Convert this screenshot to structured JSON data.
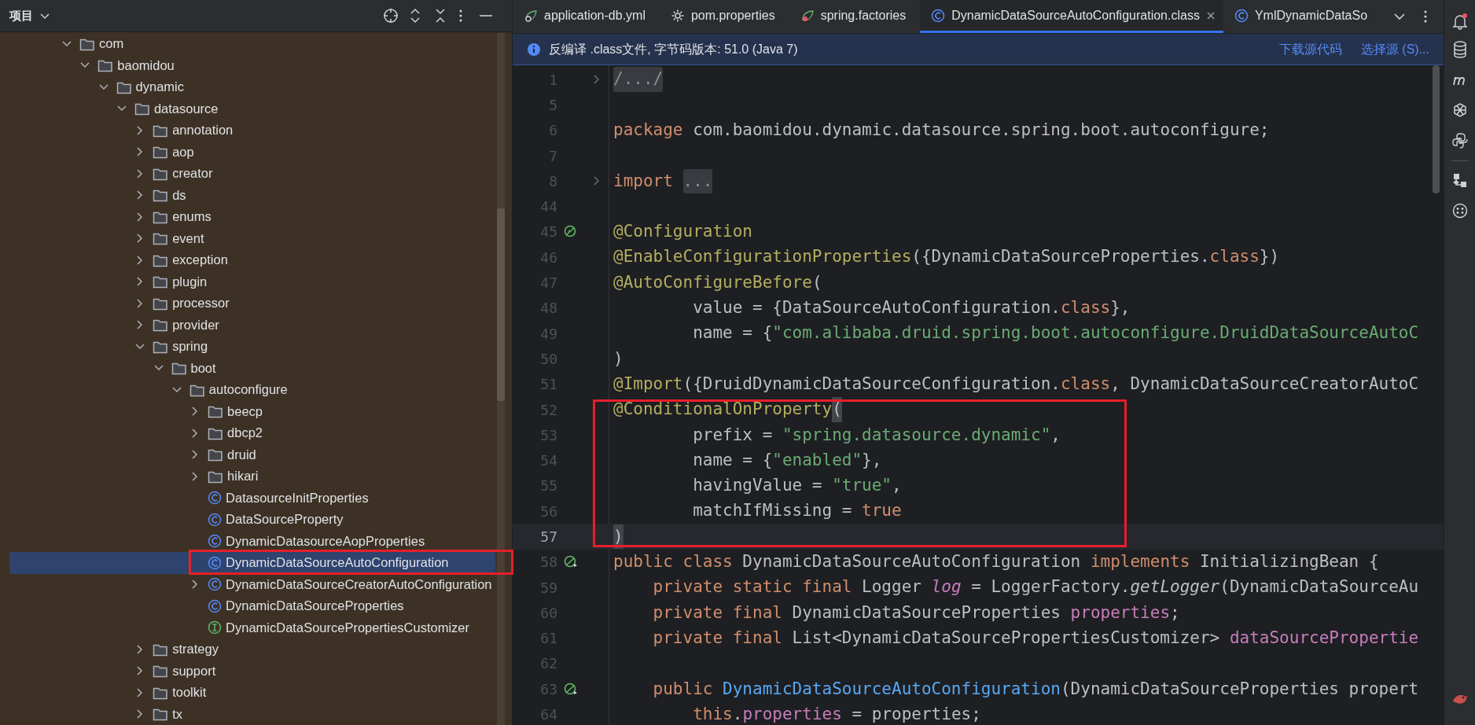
{
  "project": {
    "title": "项目",
    "tree": [
      {
        "label": "com",
        "kind": "folder",
        "expanded": true,
        "selected": false,
        "children": [
          {
            "label": "baomidou",
            "kind": "folder",
            "expanded": true,
            "selected": false,
            "children": [
              {
                "label": "dynamic",
                "kind": "folder",
                "expanded": true,
                "selected": false,
                "children": [
                  {
                    "label": "datasource",
                    "kind": "folder",
                    "expanded": true,
                    "selected": false,
                    "children": [
                      {
                        "label": "annotation",
                        "kind": "folder",
                        "expanded": false,
                        "selected": false
                      },
                      {
                        "label": "aop",
                        "kind": "folder",
                        "expanded": false,
                        "selected": false
                      },
                      {
                        "label": "creator",
                        "kind": "folder",
                        "expanded": false,
                        "selected": false
                      },
                      {
                        "label": "ds",
                        "kind": "folder",
                        "expanded": false,
                        "selected": false
                      },
                      {
                        "label": "enums",
                        "kind": "folder",
                        "expanded": false,
                        "selected": false
                      },
                      {
                        "label": "event",
                        "kind": "folder",
                        "expanded": false,
                        "selected": false
                      },
                      {
                        "label": "exception",
                        "kind": "folder",
                        "expanded": false,
                        "selected": false
                      },
                      {
                        "label": "plugin",
                        "kind": "folder",
                        "expanded": false,
                        "selected": false
                      },
                      {
                        "label": "processor",
                        "kind": "folder",
                        "expanded": false,
                        "selected": false
                      },
                      {
                        "label": "provider",
                        "kind": "folder",
                        "expanded": false,
                        "selected": false
                      },
                      {
                        "label": "spring",
                        "kind": "folder",
                        "expanded": true,
                        "selected": false,
                        "children": [
                          {
                            "label": "boot",
                            "kind": "folder",
                            "expanded": true,
                            "selected": false,
                            "children": [
                              {
                                "label": "autoconfigure",
                                "kind": "folder",
                                "expanded": true,
                                "selected": false,
                                "children": [
                                  {
                                    "label": "beecp",
                                    "kind": "folder",
                                    "expanded": false,
                                    "selected": false
                                  },
                                  {
                                    "label": "dbcp2",
                                    "kind": "folder",
                                    "expanded": false,
                                    "selected": false
                                  },
                                  {
                                    "label": "druid",
                                    "kind": "folder",
                                    "expanded": false,
                                    "selected": false
                                  },
                                  {
                                    "label": "hikari",
                                    "kind": "folder",
                                    "expanded": false,
                                    "selected": false
                                  },
                                  {
                                    "label": "DatasourceInitProperties",
                                    "kind": "class",
                                    "selected": false
                                  },
                                  {
                                    "label": "DataSourceProperty",
                                    "kind": "class",
                                    "selected": false
                                  },
                                  {
                                    "label": "DynamicDatasourceAopProperties",
                                    "kind": "class",
                                    "selected": false
                                  },
                                  {
                                    "label": "DynamicDataSourceAutoConfiguration",
                                    "kind": "class",
                                    "selected": true
                                  },
                                  {
                                    "label": "DynamicDataSourceCreatorAutoConfiguration",
                                    "kind": "class",
                                    "expanded": false,
                                    "selected": false
                                  },
                                  {
                                    "label": "DynamicDataSourceProperties",
                                    "kind": "class",
                                    "selected": false
                                  },
                                  {
                                    "label": "DynamicDataSourcePropertiesCustomizer",
                                    "kind": "interface",
                                    "selected": false
                                  }
                                ]
                              }
                            ]
                          }
                        ]
                      },
                      {
                        "label": "strategy",
                        "kind": "folder",
                        "expanded": false,
                        "selected": false
                      },
                      {
                        "label": "support",
                        "kind": "folder",
                        "expanded": false,
                        "selected": false
                      },
                      {
                        "label": "toolkit",
                        "kind": "folder",
                        "expanded": false,
                        "selected": false
                      },
                      {
                        "label": "tx",
                        "kind": "folder",
                        "expanded": false,
                        "selected": false
                      }
                    ]
                  }
                ]
              }
            ]
          }
        ]
      }
    ]
  },
  "editor": {
    "tabs": [
      {
        "label": "application-db.yml",
        "kind": "spring-config",
        "selected": false
      },
      {
        "label": "pom.properties",
        "kind": "properties",
        "selected": false
      },
      {
        "label": "spring.factories",
        "kind": "spring-factories",
        "selected": false
      },
      {
        "label": "DynamicDataSourceAutoConfiguration.class",
        "kind": "class",
        "selected": true
      },
      {
        "label": "YmlDynamicDataSo",
        "kind": "class",
        "selected": false
      }
    ],
    "notice": {
      "text": "反编译 .class文件, 字节码版本: 51.0 (Java 7)",
      "links": [
        "下载源代码",
        "选择源 (S)..."
      ]
    },
    "lines": [
      {
        "number": "1",
        "fold_marker": true,
        "current": false,
        "tokens": [
          {
            "kind": "folded",
            "text": "/.../"
          }
        ]
      },
      {
        "number": "5",
        "current": false
      },
      {
        "number": "6",
        "current": false,
        "tokens": [
          {
            "kind": "keyword",
            "text": "package"
          },
          {
            "kind": "plain",
            "text": " com.baomidou.dynamic.datasource.spring.boot.autoconfigure;"
          }
        ]
      },
      {
        "number": "7",
        "current": false
      },
      {
        "number": "8",
        "fold_marker": true,
        "current": false,
        "tokens": [
          {
            "kind": "keyword",
            "text": "import "
          },
          {
            "kind": "folded",
            "text": "..."
          }
        ]
      },
      {
        "number": "44",
        "current": false
      },
      {
        "number": "45",
        "kind": "bean",
        "current": false,
        "tokens": [
          {
            "kind": "annotation",
            "text": "@Configuration"
          }
        ]
      },
      {
        "number": "46",
        "current": false,
        "tokens": [
          {
            "kind": "annotation",
            "text": "@EnableConfigurationProperties"
          },
          {
            "kind": "plain",
            "text": "({DynamicDataSourceProperties."
          },
          {
            "kind": "keyword",
            "text": "class"
          },
          {
            "kind": "plain",
            "text": "})"
          }
        ]
      },
      {
        "number": "47",
        "current": false,
        "tokens": [
          {
            "kind": "annotation",
            "text": "@AutoConfigureBefore"
          },
          {
            "kind": "plain",
            "text": "("
          }
        ]
      },
      {
        "number": "48",
        "current": false,
        "tokens": [
          {
            "kind": "plain",
            "text": "        value = {DataSourceAutoConfiguration."
          },
          {
            "kind": "keyword",
            "text": "class"
          },
          {
            "kind": "plain",
            "text": "},"
          }
        ]
      },
      {
        "number": "49",
        "current": false,
        "tokens": [
          {
            "kind": "plain",
            "text": "        name = {"
          },
          {
            "kind": "string",
            "text": "\"com.alibaba.druid.spring.boot.autoconfigure.DruidDataSourceAutoC"
          }
        ]
      },
      {
        "number": "50",
        "current": false,
        "tokens": [
          {
            "kind": "plain",
            "text": ")"
          }
        ]
      },
      {
        "number": "51",
        "current": false,
        "tokens": [
          {
            "kind": "annotation",
            "text": "@Import"
          },
          {
            "kind": "plain",
            "text": "({DruidDynamicDataSourceConfiguration."
          },
          {
            "kind": "keyword",
            "text": "class"
          },
          {
            "kind": "plain",
            "text": ", DynamicDataSourceCreatorAutoC"
          }
        ]
      },
      {
        "number": "52",
        "current": false,
        "tokens": [
          {
            "kind": "annotation",
            "text": "@ConditionalOnProperty"
          },
          {
            "kind": "bracket-match",
            "text": "("
          }
        ]
      },
      {
        "number": "53",
        "current": false,
        "tokens": [
          {
            "kind": "plain",
            "text": "        prefix = "
          },
          {
            "kind": "string",
            "text": "\"spring.datasource.dynamic\""
          },
          {
            "kind": "plain",
            "text": ","
          }
        ]
      },
      {
        "number": "54",
        "current": false,
        "tokens": [
          {
            "kind": "plain",
            "text": "        name = {"
          },
          {
            "kind": "string",
            "text": "\"enabled\""
          },
          {
            "kind": "plain",
            "text": "},"
          }
        ]
      },
      {
        "number": "55",
        "current": false,
        "tokens": [
          {
            "kind": "plain",
            "text": "        havingValue = "
          },
          {
            "kind": "string",
            "text": "\"true\""
          },
          {
            "kind": "plain",
            "text": ","
          }
        ]
      },
      {
        "number": "56",
        "current": false,
        "tokens": [
          {
            "kind": "plain",
            "text": "        matchIfMissing = "
          },
          {
            "kind": "keyword",
            "text": "true"
          }
        ]
      },
      {
        "number": "57",
        "current": true,
        "tokens": [
          {
            "kind": "bracket-match",
            "text": ")"
          }
        ]
      },
      {
        "number": "58",
        "kind": "bean-linked",
        "current": false,
        "tokens": [
          {
            "kind": "keyword",
            "text": "public class"
          },
          {
            "kind": "plain",
            "text": " DynamicDataSourceAutoConfiguration "
          },
          {
            "kind": "keyword",
            "text": "implements"
          },
          {
            "kind": "plain",
            "text": " InitializingBean {"
          }
        ]
      },
      {
        "number": "59",
        "current": false,
        "tokens": [
          {
            "kind": "keyword",
            "text": "    private static final"
          },
          {
            "kind": "plain",
            "text": " Logger "
          },
          {
            "kind": "static-field",
            "text": "log"
          },
          {
            "kind": "plain",
            "text": " = LoggerFactory."
          },
          {
            "kind": "static-method",
            "text": "getLogger"
          },
          {
            "kind": "plain",
            "text": "(DynamicDataSourceAu"
          }
        ]
      },
      {
        "number": "60",
        "current": false,
        "tokens": [
          {
            "kind": "keyword",
            "text": "    private final"
          },
          {
            "kind": "plain",
            "text": " DynamicDataSourceProperties "
          },
          {
            "kind": "field",
            "text": "properties"
          },
          {
            "kind": "plain",
            "text": ";"
          }
        ]
      },
      {
        "number": "61",
        "current": false,
        "tokens": [
          {
            "kind": "keyword",
            "text": "    private final"
          },
          {
            "kind": "plain",
            "text": " List<DynamicDataSourcePropertiesCustomizer> "
          },
          {
            "kind": "field",
            "text": "dataSourcePropertie"
          }
        ]
      },
      {
        "number": "62",
        "current": false
      },
      {
        "number": "63",
        "kind": "bean-linked",
        "current": false,
        "tokens": [
          {
            "kind": "keyword",
            "text": "    public "
          },
          {
            "kind": "declaration",
            "text": "DynamicDataSourceAutoConfiguration"
          },
          {
            "kind": "plain",
            "text": "(DynamicDataSourceProperties propert"
          }
        ]
      },
      {
        "number": "64",
        "current": false,
        "tokens": [
          {
            "kind": "keyword",
            "text": "        this"
          },
          {
            "kind": "plain",
            "text": "."
          },
          {
            "kind": "field",
            "text": "properties"
          },
          {
            "kind": "plain",
            "text": " = properties;"
          }
        ]
      }
    ]
  }
}
